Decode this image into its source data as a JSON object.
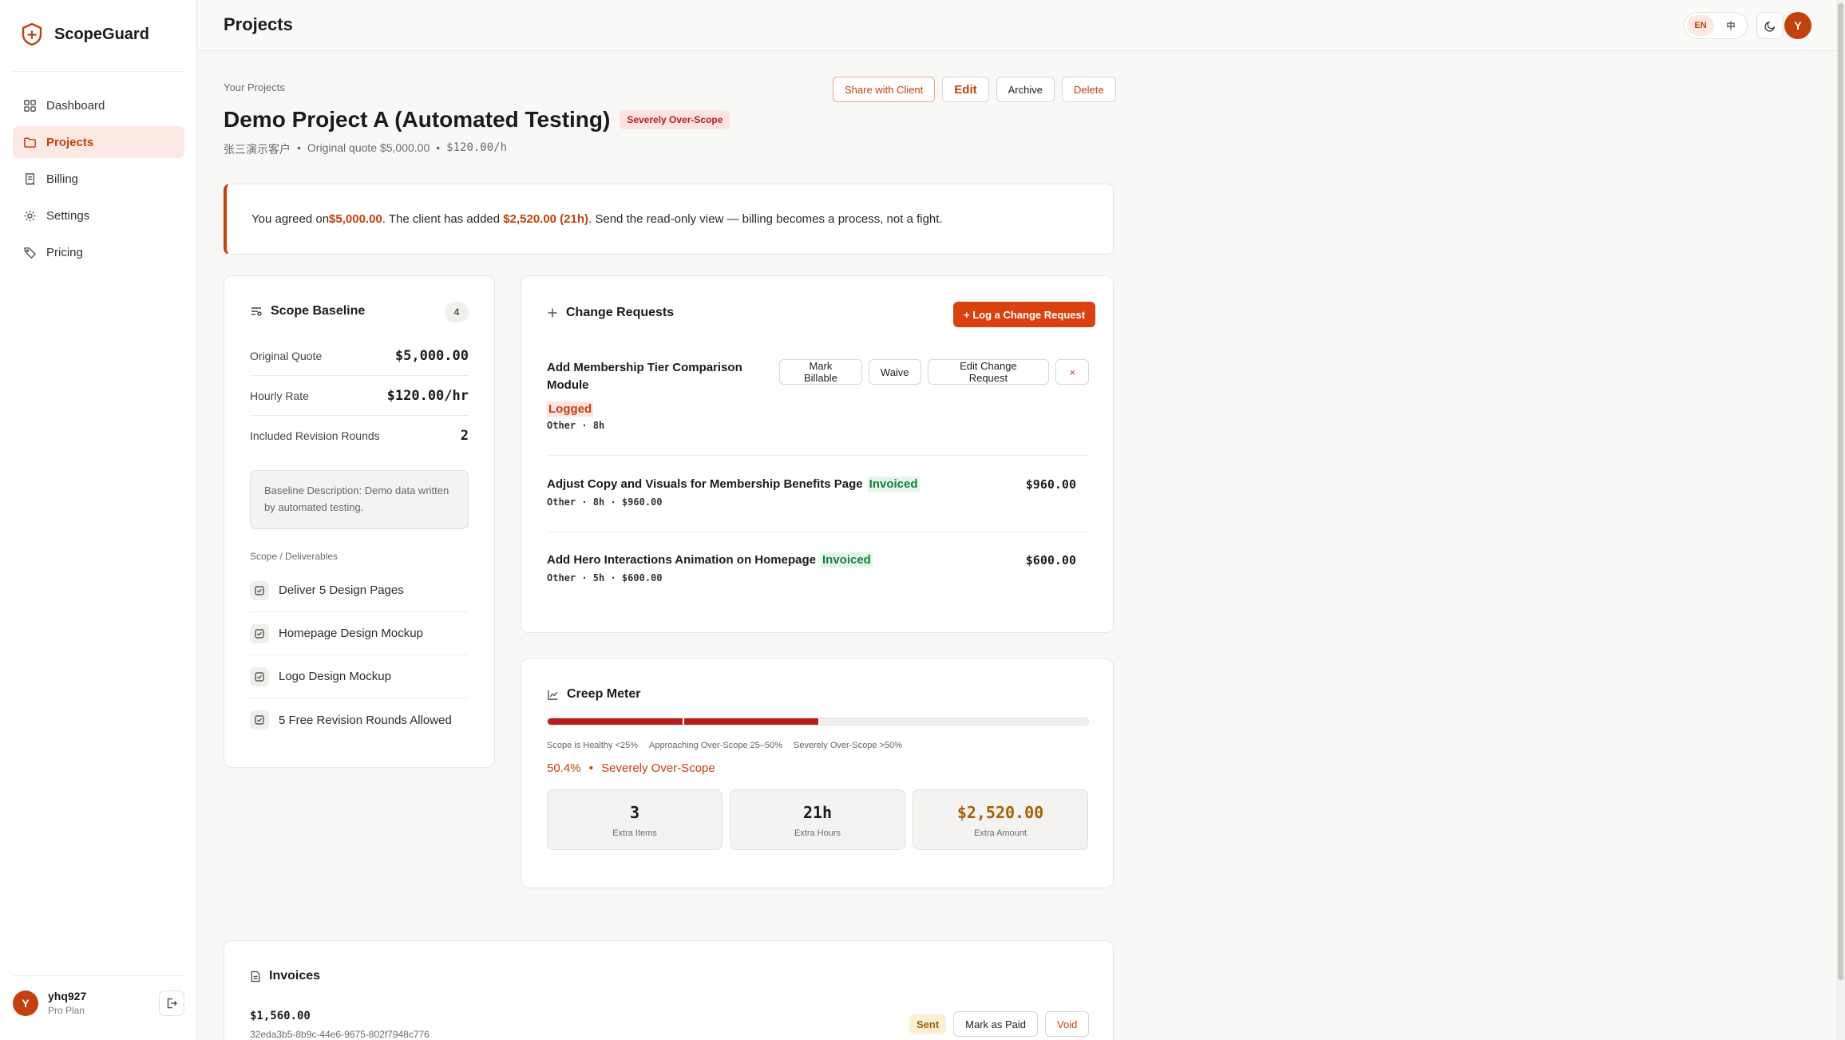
{
  "app": {
    "name": "ScopeGuard"
  },
  "nav": [
    {
      "label": "Dashboard",
      "icon": "grid-icon"
    },
    {
      "label": "Projects",
      "icon": "folder-icon",
      "active": true
    },
    {
      "label": "Billing",
      "icon": "receipt-icon"
    },
    {
      "label": "Settings",
      "icon": "gear-icon"
    },
    {
      "label": "Pricing",
      "icon": "tag-icon"
    }
  ],
  "user": {
    "initial": "Y",
    "name": "yhq927",
    "plan": "Pro Plan"
  },
  "topbar": {
    "title": "Projects",
    "lang_en": "EN",
    "lang_zh": "中",
    "avatar_initial": "Y"
  },
  "header": {
    "eyebrow": "Your Projects",
    "title": "Demo Project A (Automated Testing)",
    "status_badge": "Severely Over-Scope",
    "client": "张三演示客户",
    "quote": "Original quote $5,000.00",
    "rate": "$120.00/h",
    "sep": "•",
    "actions": {
      "share": "Share with Client",
      "edit": "Edit",
      "archive": "Archive",
      "delete": "Delete"
    }
  },
  "alert": {
    "pre": "You agreed on ",
    "agreed": "$5,000.00",
    "mid": ". The client has added ",
    "added": "$2,520.00 (21h)",
    "post": ". Send the read-only view — billing becomes a process, not a fight."
  },
  "baseline": {
    "title": "Scope Baseline",
    "count": "4",
    "rows": [
      {
        "label": "Original Quote",
        "value": "$5,000.00"
      },
      {
        "label": "Hourly Rate",
        "value": "$120.00/hr"
      },
      {
        "label": "Included Revision Rounds",
        "value": "2"
      }
    ],
    "description": "Baseline Description: Demo data written by automated testing.",
    "deliverables_head": "Scope / Deliverables",
    "deliverables": [
      "Deliver 5 Design Pages",
      "Homepage Design Mockup",
      "Logo Design Mockup",
      "5 Free Revision Rounds Allowed"
    ]
  },
  "changes": {
    "title": "Change Requests",
    "log_button": "+ Log a Change Request",
    "items": [
      {
        "title": "Add Membership Tier Comparison Module",
        "status": "Logged",
        "meta": "Other · 8h",
        "actions": {
          "billable": "Mark Billable",
          "waive": "Waive",
          "edit": "Edit Change Request",
          "remove": "×"
        }
      },
      {
        "title": "Adjust Copy and Visuals for Membership Benefits Page",
        "status": "Invoiced",
        "meta": "Other · 8h · $960.00",
        "amount": "$960.00"
      },
      {
        "title": "Add Hero Interactions Animation on Homepage",
        "status": "Invoiced",
        "meta": "Other · 5h · $600.00",
        "amount": "$600.00"
      }
    ]
  },
  "creep": {
    "title": "Creep Meter",
    "percent": 50.4,
    "legend": [
      "Scope is Healthy <25%",
      "Approaching Over-Scope 25–50%",
      "Severely Over-Scope >50%"
    ],
    "readout_pct": "50.4%",
    "readout_sep": "•",
    "readout_label": "Severely Over-Scope",
    "stats": [
      {
        "value": "3",
        "label": "Extra Items"
      },
      {
        "value": "21h",
        "label": "Extra Hours"
      },
      {
        "value": "$2,520.00",
        "label": "Extra Amount"
      }
    ],
    "colors": {
      "fill": "#b91c1c",
      "accent": "#c2410c"
    }
  },
  "invoices": {
    "title": "Invoices",
    "items": [
      {
        "amount": "$1,560.00",
        "id": "32eda3b5-8b9c-44e6-9675-802f7948c776",
        "status": "Sent",
        "actions": {
          "paid": "Mark as Paid",
          "void": "Void"
        }
      }
    ]
  }
}
